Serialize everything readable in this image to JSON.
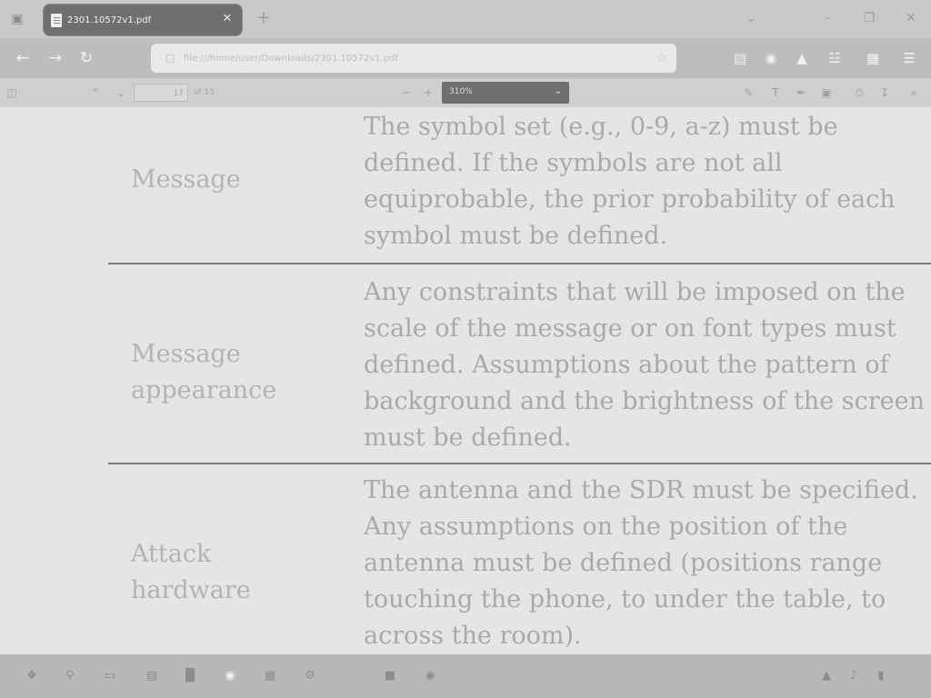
{
  "browser": {
    "tab_list_icon": "tab-list-icon",
    "tab": {
      "title": "2301.10572v1.pdf",
      "close_icon": "close-icon"
    },
    "new_tab_icon": "plus-icon",
    "window_controls": [
      "chevron-down-icon",
      "minimize-icon",
      "restore-icon",
      "close-icon"
    ]
  },
  "navbar": {
    "back_icon": "back-arrow-icon",
    "forward_icon": "forward-arrow-icon",
    "reload_icon": "reload-icon",
    "url": "file:///home/user/Downloads/2301.10572v1.pdf",
    "url_icon": "file-icon",
    "bookmark_icon": "star-icon",
    "toolbar_icons": [
      "pocket-icon",
      "account-icon",
      "extensions-icon",
      "downloads-icon",
      "library-icon",
      "menu-icon"
    ]
  },
  "pdf_toolbar": {
    "sidebar_icon": "sidebar-toggle-icon",
    "prev_icon": "chevron-up-icon",
    "next_icon": "chevron-down-icon",
    "page_number": "17",
    "page_total": "of 15",
    "zoom_out_icon": "minus-icon",
    "zoom_in_icon": "plus-icon",
    "zoom_value": "310%",
    "right_icons": [
      "highlight-icon",
      "text-icon",
      "draw-icon",
      "image-icon",
      "print-icon",
      "save-icon",
      "more-icon"
    ]
  },
  "document": {
    "rows": [
      {
        "label": [
          "Message"
        ],
        "text": [
          "The symbol set (e.g., 0-9, a-z) must be",
          "defined. If the symbols are not all",
          "equiprobable, the prior probability of each",
          "symbol must be defined."
        ]
      },
      {
        "label": [
          "Message",
          "appearance"
        ],
        "text": [
          "Any constraints that will be imposed on the",
          "scale of the message or on font types must",
          "defined. Assumptions about the pattern of",
          "background and the brightness of the screen",
          "must be defined."
        ]
      },
      {
        "label": [
          "Attack",
          "hardware"
        ],
        "text": [
          "The antenna and the SDR must be specified.",
          "Any assumptions on the position of the",
          "antenna must be defined (positions range",
          "touching the phone, to under the table, to",
          "across the room)."
        ]
      }
    ]
  },
  "taskbar": {
    "icons": [
      "start-icon",
      "search-icon",
      "task-view-icon",
      "files-icon",
      "terminal-icon",
      "browser-icon",
      "document-icon",
      "settings-icon",
      "app-icon",
      "app-icon"
    ],
    "tray_icons": [
      "network-icon",
      "volume-icon",
      "battery-icon"
    ]
  }
}
